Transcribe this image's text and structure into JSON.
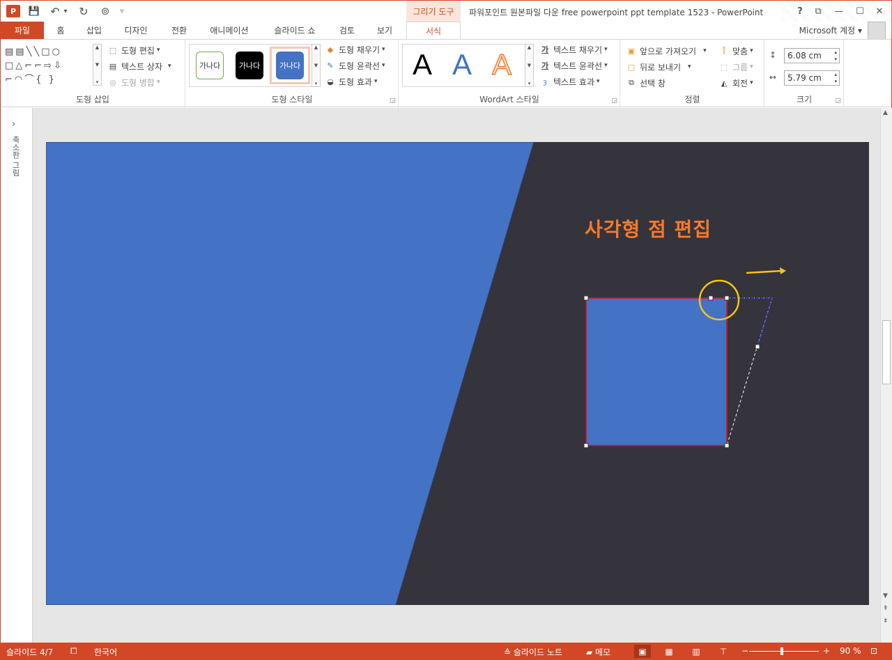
{
  "window": {
    "title": "파워포인트 원본파일 다운 free powerpoint ppt template 1523 - PowerPoint",
    "app_icon": "P",
    "context_tab_header": "그리기 도구",
    "help": "?",
    "restore_ribbon": "⧉",
    "minimize": "—",
    "maximize": "☐",
    "close": "✕"
  },
  "qat": {
    "save": "💾",
    "undo": "↶",
    "undo_more": "▾",
    "redo": "↻",
    "present": "⊚",
    "customize": "▿"
  },
  "tabs": [
    "파일",
    "홈",
    "삽입",
    "디자인",
    "전환",
    "애니메이션",
    "슬라이드 쇼",
    "검토",
    "보기",
    "서식"
  ],
  "account": {
    "label": "Microsoft 계정",
    "caret": "▾"
  },
  "ribbon": {
    "insert_shapes": {
      "shape_rows": [
        "▤▤╲╲□○",
        "□△⌐⌐⇨⇩",
        "⌐◠⌒{ }"
      ],
      "edit_shape": "도형 편집",
      "text_box": "텍스트 상자",
      "merge_shapes": "도형 병합",
      "group_label": "도형 삽입"
    },
    "shape_styles": {
      "swatches": [
        "가나다",
        "가나다",
        "가나다"
      ],
      "fill": "도형 채우기",
      "outline": "도형 윤곽선",
      "effects": "도형 효과",
      "group_label": "도형 스타일"
    },
    "wordart": {
      "letters": [
        "A",
        "A",
        "A"
      ],
      "text_fill": "텍스트 채우기",
      "text_outline": "텍스트 윤곽선",
      "text_effects": "텍스트 효과",
      "group_label": "WordArt 스타일"
    },
    "arrange": {
      "bring_forward": "앞으로 가져오기",
      "send_backward": "뒤로 보내기",
      "selection_pane": "선택 창",
      "align": "맞춤",
      "group": "그룹",
      "rotate": "회전",
      "group_label": "정렬"
    },
    "size": {
      "height": "6.08 cm",
      "width": "5.79 cm",
      "group_label": "크기"
    }
  },
  "left_pane": {
    "expand": "›",
    "label": "축소판 그림"
  },
  "slide": {
    "caption": "사각형 점 편집",
    "colors": {
      "background": "#35333b",
      "blue": "#4472c4",
      "orange": "#f47a2c",
      "yellow": "#f5c518"
    }
  },
  "status": {
    "slide_no": "슬라이드 4/7",
    "language": "한국어",
    "notes": "슬라이드 노트",
    "comments": "메모",
    "zoom": "90 %",
    "zoom_minus": "−",
    "zoom_plus": "+"
  }
}
